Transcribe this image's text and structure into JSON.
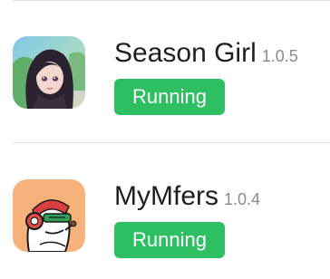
{
  "apps": [
    {
      "name": "Season Girl",
      "version": "1.0.5",
      "status": "Running",
      "icon": "season-girl-app-icon"
    },
    {
      "name": "MyMfers",
      "version": "1.0.4",
      "status": "Running",
      "icon": "mymfers-app-icon"
    }
  ],
  "colors": {
    "status_running": "#2ebf62",
    "divider": "#e1e1e1",
    "title_text": "#1f1f1f",
    "version_text": "#8a8a8a"
  }
}
